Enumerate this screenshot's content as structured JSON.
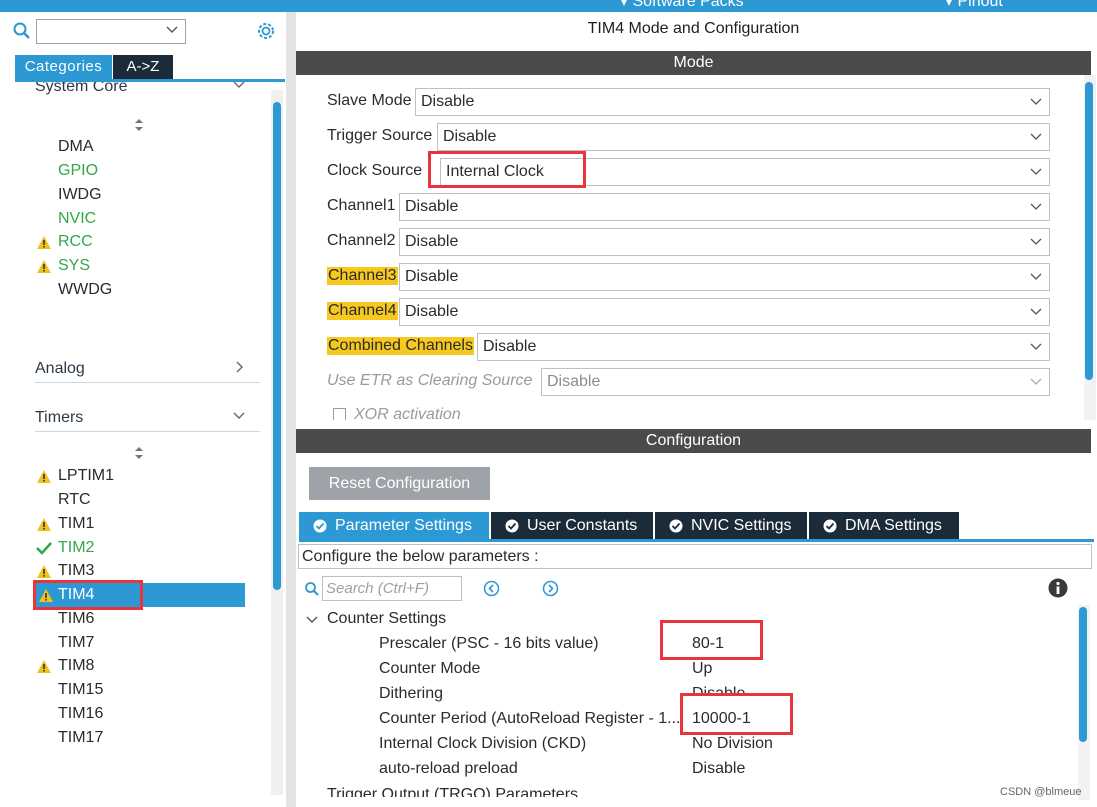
{
  "topbar": {
    "software_packs": "Software Packs",
    "pinout": "Pinout"
  },
  "left": {
    "tabs": {
      "categories": "Categories",
      "az": "A->Z"
    },
    "system_core": {
      "title": "System Core",
      "items": [
        {
          "label": "DMA",
          "status": "none"
        },
        {
          "label": "GPIO",
          "status": "green"
        },
        {
          "label": "IWDG",
          "status": "none"
        },
        {
          "label": "NVIC",
          "status": "green"
        },
        {
          "label": "RCC",
          "status": "warning"
        },
        {
          "label": "SYS",
          "status": "warning"
        },
        {
          "label": "WWDG",
          "status": "none"
        }
      ]
    },
    "analog": {
      "title": "Analog"
    },
    "timers": {
      "title": "Timers",
      "items": [
        {
          "label": "LPTIM1",
          "status": "warning"
        },
        {
          "label": "RTC",
          "status": "none"
        },
        {
          "label": "TIM1",
          "status": "warning"
        },
        {
          "label": "TIM2",
          "status": "check"
        },
        {
          "label": "TIM3",
          "status": "warning"
        },
        {
          "label": "TIM4",
          "status": "warning-selected"
        },
        {
          "label": "TIM6",
          "status": "none"
        },
        {
          "label": "TIM7",
          "status": "none"
        },
        {
          "label": "TIM8",
          "status": "warning"
        },
        {
          "label": "TIM15",
          "status": "none"
        },
        {
          "label": "TIM16",
          "status": "none"
        },
        {
          "label": "TIM17",
          "status": "none"
        }
      ]
    }
  },
  "right": {
    "title": "TIM4 Mode and Configuration",
    "mode_bar": "Mode",
    "mode_rows": [
      {
        "label": "Slave Mode",
        "value": "Disable"
      },
      {
        "label": "Trigger Source",
        "value": "Disable"
      },
      {
        "label": "Clock Source",
        "value": "Internal Clock"
      },
      {
        "label": "Channel1",
        "value": "Disable"
      },
      {
        "label": "Channel2",
        "value": "Disable"
      },
      {
        "label": "Channel3",
        "value": "Disable"
      },
      {
        "label": "Channel4",
        "value": "Disable"
      },
      {
        "label": "Combined Channels",
        "value": "Disable"
      },
      {
        "label": "Use ETR as Clearing Source",
        "value": "Disable"
      }
    ],
    "xor_label": "XOR activation",
    "config_bar": "Configuration",
    "reset_button": "Reset Configuration",
    "tabs": [
      "Parameter Settings",
      "User Constants",
      "NVIC Settings",
      "DMA Settings"
    ],
    "configure_text": "Configure the below parameters :",
    "search_placeholder": "Search (Ctrl+F)",
    "group_title": "Counter Settings",
    "params": [
      {
        "name": "Prescaler (PSC - 16 bits value)",
        "value": "80-1"
      },
      {
        "name": "Counter Mode",
        "value": "Up"
      },
      {
        "name": "Dithering",
        "value": "Disable"
      },
      {
        "name": "Counter Period (AutoReload Register - 1...",
        "value": "10000-1"
      },
      {
        "name": "Internal Clock Division (CKD)",
        "value": "No Division"
      },
      {
        "name": "auto-reload preload",
        "value": "Disable"
      }
    ],
    "next_group": "Trigger Output (TRGO) Parameters"
  },
  "watermark": "CSDN @blmeue",
  "colors": {
    "accent": "#2c98d4",
    "highlight": "#f7c81e",
    "red_box": "#e8343a",
    "dark_bar": "#4a4a4a"
  }
}
